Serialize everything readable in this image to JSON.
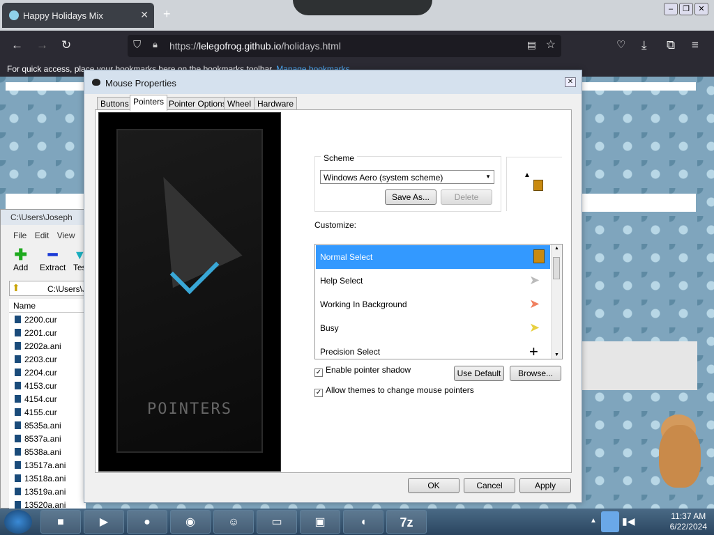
{
  "browser": {
    "tab_title": "Happy Holidays Mix",
    "new_tab": "+",
    "url_prefix": "https://",
    "url_domain": "lelegofrog.github.io",
    "url_path": "/holidays.html",
    "bookmarks_text": "For quick access, place your bookmarks here on the bookmarks toolbar.",
    "bookmarks_link": "Manage bookmarks..."
  },
  "sevenzip": {
    "title": "C:\\Users\\Joseph",
    "menu": [
      "File",
      "Edit",
      "View"
    ],
    "tools": [
      "Add",
      "Extract",
      "Tes"
    ],
    "path": "C:\\Users\\J",
    "column": "Name",
    "files": [
      "2200.cur",
      "2201.cur",
      "2202a.ani",
      "2203.cur",
      "2204.cur",
      "4153.cur",
      "4154.cur",
      "4155.cur",
      "8535a.ani",
      "8537a.ani",
      "8538a.ani",
      "13517a.ani",
      "13518a.ani",
      "13519a.ani",
      "13520a.ani"
    ]
  },
  "dialog": {
    "title": "Mouse Properties",
    "tabs": [
      "Buttons",
      "Pointers",
      "Pointer Options",
      "Wheel",
      "Hardware"
    ],
    "preview_text": "POINTERS",
    "scheme_label": "Scheme",
    "scheme_value": "Windows Aero (system scheme)",
    "save_as": "Save As...",
    "delete": "Delete",
    "customize_label": "Customize:",
    "pointers": [
      "Normal Select",
      "Help Select",
      "Working In Background",
      "Busy",
      "Precision Select"
    ],
    "shadow_label": "Enable pointer shadow",
    "themes_label": "Allow themes to change mouse pointers",
    "use_default": "Use Default",
    "browse": "Browse...",
    "ok": "OK",
    "cancel": "Cancel",
    "apply": "Apply"
  },
  "taskbar": {
    "time": "11:37 AM",
    "date": "6/22/2024",
    "zip_label": "7z"
  }
}
